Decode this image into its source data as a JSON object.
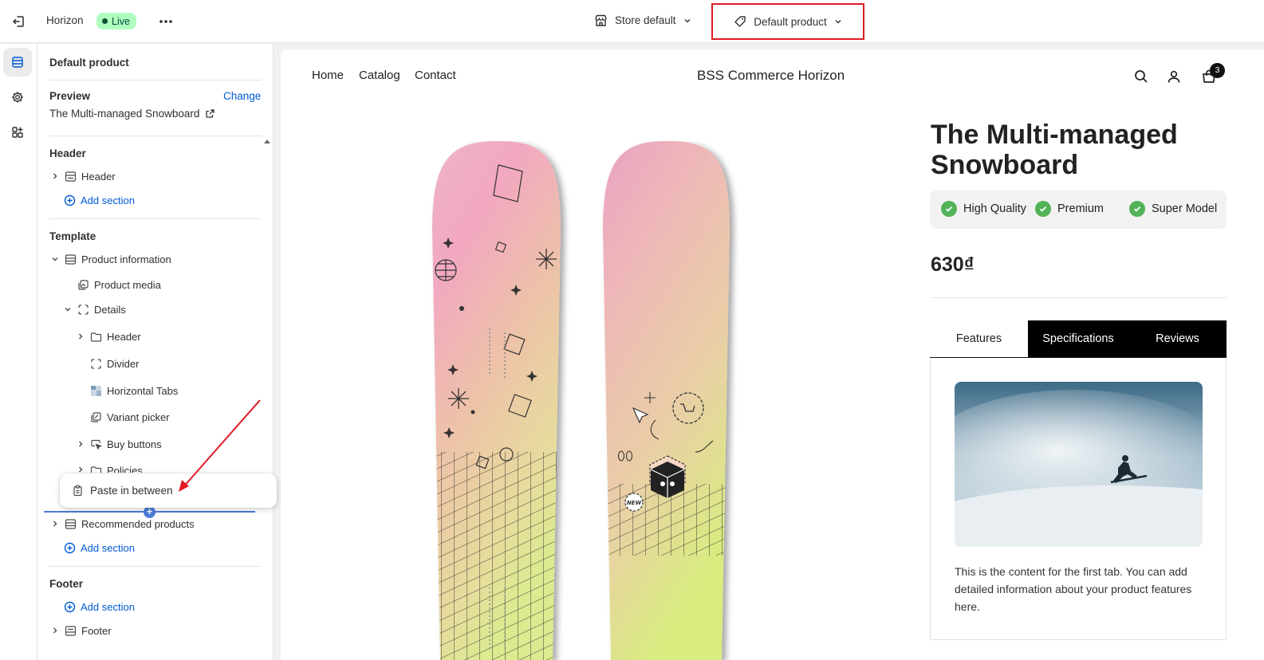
{
  "topbar": {
    "theme_name": "Horizon",
    "status_badge": "Live",
    "store_selector": "Store default",
    "template_selector": "Default product"
  },
  "rail": {
    "items": [
      {
        "icon": "sections-icon",
        "active": true
      },
      {
        "icon": "gear-icon",
        "active": false
      },
      {
        "icon": "apps-icon",
        "active": false
      }
    ]
  },
  "sidebar": {
    "title": "Default product",
    "preview_label": "Preview",
    "change_link": "Change",
    "preview_product": "The Multi-managed Snowboard",
    "header_group": "Header",
    "header_item": "Header",
    "add_section": "Add section",
    "template_group": "Template",
    "template_items": {
      "product_information": "Product information",
      "product_media": "Product media",
      "details": "Details",
      "details_header": "Header",
      "divider": "Divider",
      "horizontal_tabs": "Horizontal Tabs",
      "variant_picker": "Variant picker",
      "buy_buttons": "Buy buttons",
      "policies": "Policies",
      "recommended_products": "Recommended products"
    },
    "footer_group": "Footer",
    "footer_item": "Footer"
  },
  "popover": {
    "paste_label": "Paste in between"
  },
  "preview": {
    "nav": [
      "Home",
      "Catalog",
      "Contact"
    ],
    "store_title": "BSS Commerce Horizon",
    "cart_count": "3",
    "product_title": "The Multi-managed Snowboard",
    "badges": [
      "High Quality",
      "Premium",
      "Super Model"
    ],
    "price": "630₫",
    "tabs": [
      "Features",
      "Specifications",
      "Reviews"
    ],
    "active_tab": "Features",
    "tab_content": "This is the content for the first tab. You can add detailed information about your product features here.",
    "board_sticker_text": "NEW"
  },
  "colors": {
    "accent_blue": "#005bd3",
    "live_badge_bg": "#affebf",
    "highlight_red": "#e01b24",
    "check_green": "#52b257"
  }
}
